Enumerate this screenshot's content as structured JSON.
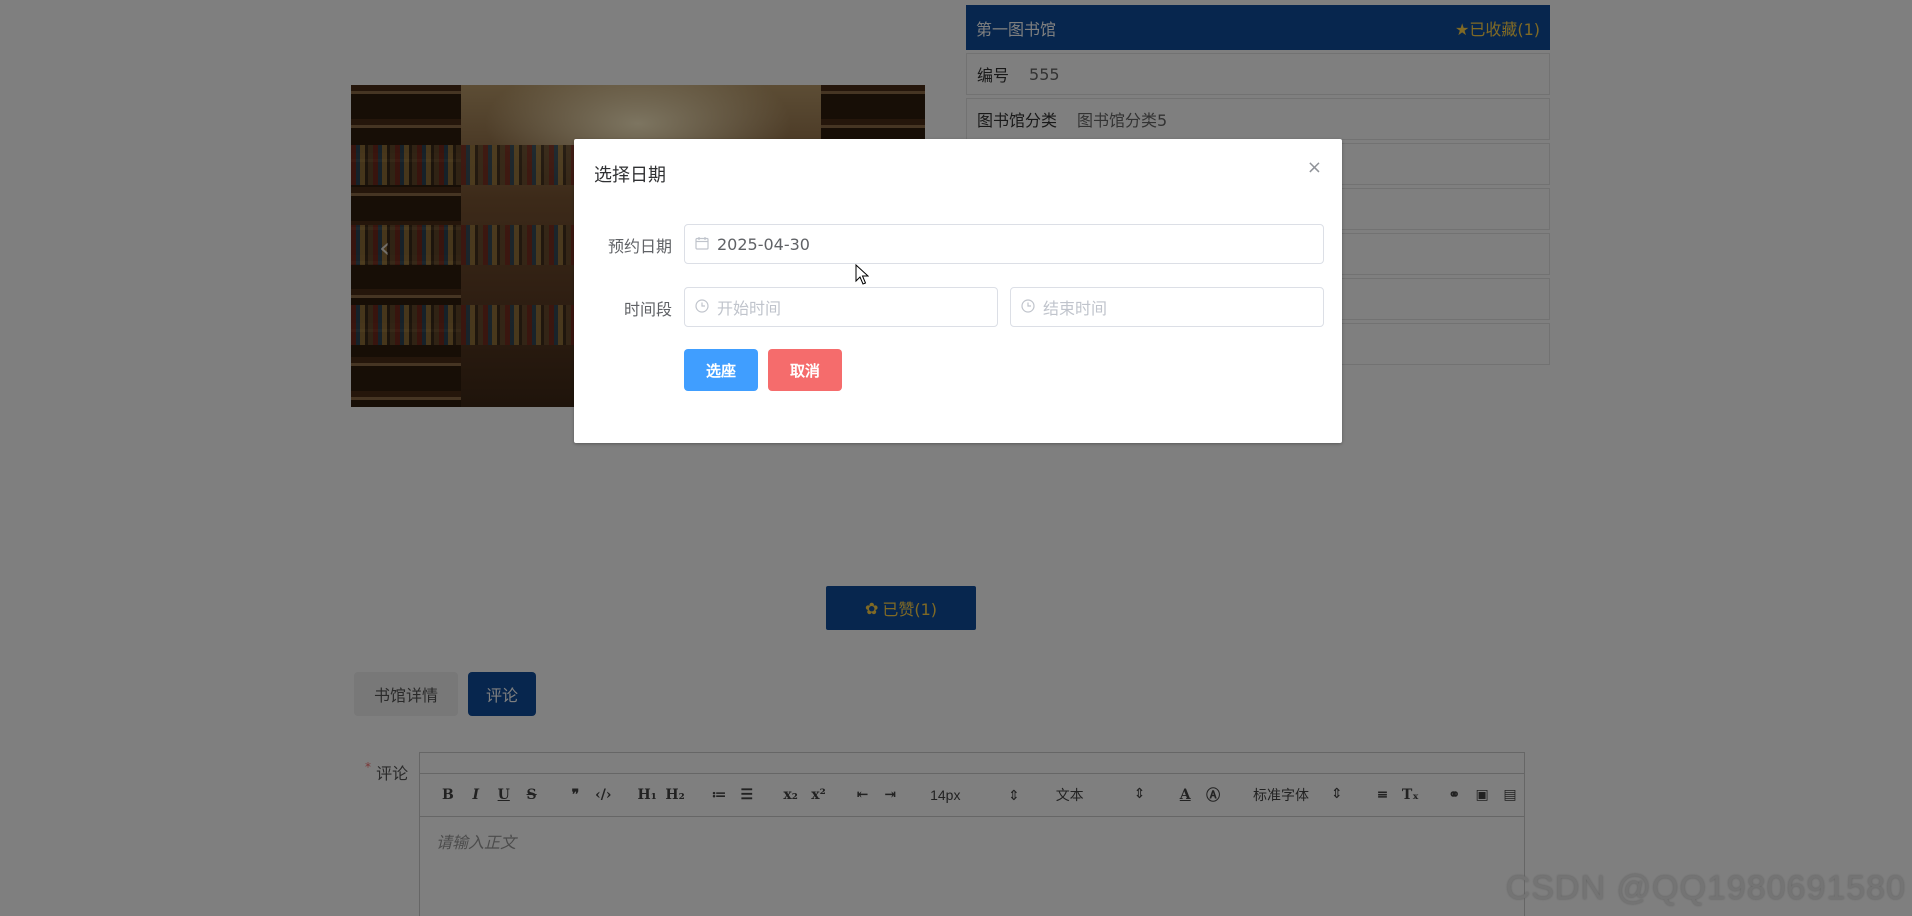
{
  "library": {
    "name": "第一图书馆",
    "favorite_label": "★已收藏(1)",
    "info_rows": [
      {
        "label": "编号",
        "value": "555"
      },
      {
        "label": "图书馆分类",
        "value": "图书馆分类5"
      }
    ],
    "like_label": "已赞(1)"
  },
  "tabs": [
    "书馆详情",
    "评论"
  ],
  "comment": {
    "required_mark": "*",
    "label": "评论",
    "placeholder": "请输入正文",
    "toolbar": {
      "font_size": "14px",
      "text_style": "文本",
      "font_family": "标准字体"
    }
  },
  "modal": {
    "title": "选择日期",
    "close_symbol": "×",
    "date_label": "预约日期",
    "date_value": "2025-04-30",
    "time_label": "时间段",
    "start_placeholder": "开始时间",
    "end_placeholder": "结束时间",
    "select_button": "选座",
    "cancel_button": "取消"
  },
  "watermark": "CSDN @QQ1980691580",
  "colors": {
    "primary_blue": "#0e4d9c",
    "accent_yellow": "#ffd24a",
    "button_blue": "#409eff",
    "button_red": "#f56c6c"
  }
}
